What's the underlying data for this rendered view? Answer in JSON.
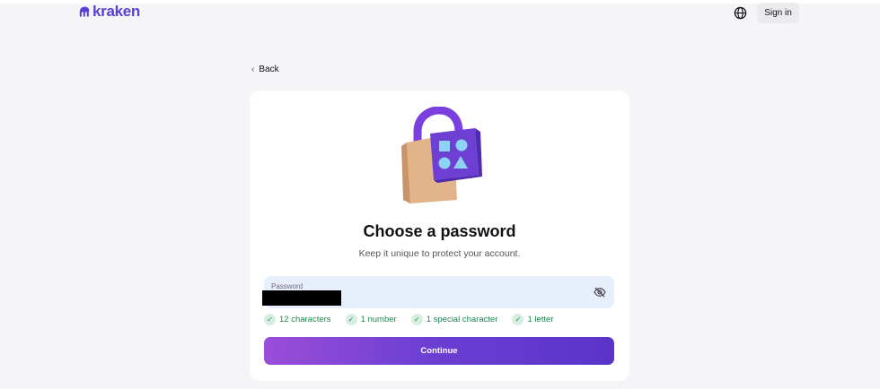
{
  "header": {
    "logo_text": "kraken",
    "signin_label": "Sign in",
    "globe_icon": "globe-icon"
  },
  "nav": {
    "back_label": "Back"
  },
  "card": {
    "illustration": "padlock-shapes-illustration",
    "title": "Choose a password",
    "subtitle": "Keep it unique to protect your account.",
    "password_field": {
      "label": "Password",
      "value": "",
      "toggle_icon": "eye-off-icon"
    },
    "requirements": [
      {
        "label": "12 characters",
        "met": true
      },
      {
        "label": "1 number",
        "met": true
      },
      {
        "label": "1 special character",
        "met": true
      },
      {
        "label": "1 letter",
        "met": true
      }
    ],
    "continue_label": "Continue"
  },
  "colors": {
    "brand": "#5741d9",
    "page_bg": "#f5f5f7",
    "card_bg": "#ffffff",
    "field_bg": "#e8effc",
    "success": "#1b8a4e",
    "button_gradient_start": "#9b4ed8",
    "button_gradient_end": "#5a34c9"
  }
}
